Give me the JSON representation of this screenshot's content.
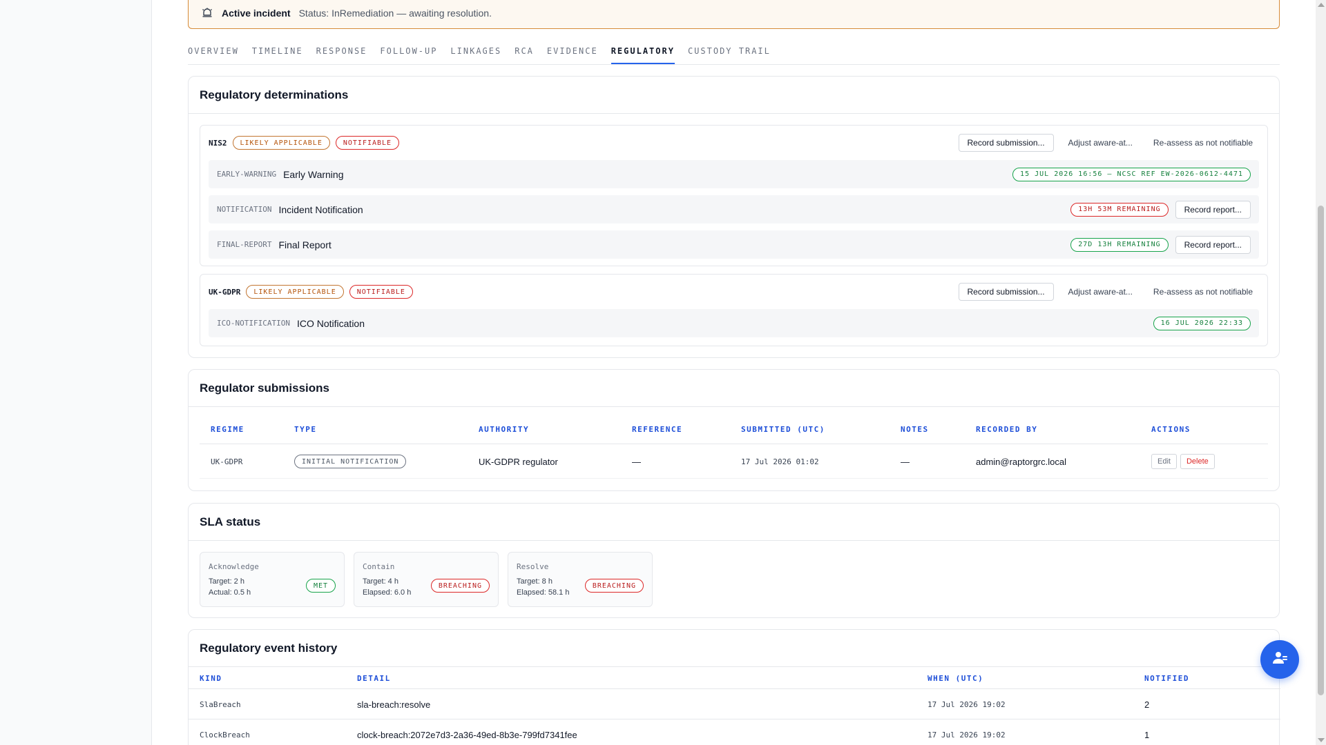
{
  "banner": {
    "icon": "bell-icon",
    "title": "Active incident",
    "status": "Status: InRemediation — awaiting resolution."
  },
  "tabs": [
    {
      "label": "OVERVIEW",
      "active": false
    },
    {
      "label": "TIMELINE",
      "active": false
    },
    {
      "label": "RESPONSE",
      "active": false
    },
    {
      "label": "FOLLOW-UP",
      "active": false
    },
    {
      "label": "LINKAGES",
      "active": false
    },
    {
      "label": "RCA",
      "active": false
    },
    {
      "label": "EVIDENCE",
      "active": false
    },
    {
      "label": "REGULATORY",
      "active": true
    },
    {
      "label": "CUSTODY TRAIL",
      "active": false
    }
  ],
  "determinations": {
    "title": "Regulatory determinations",
    "regimes": [
      {
        "name": "NIS2",
        "badges": [
          "LIKELY APPLICABLE",
          "NOTIFIABLE"
        ],
        "actions": {
          "record": "Record submission...",
          "adjust": "Adjust aware-at...",
          "reassess": "Re-assess as not notifiable"
        },
        "obligations": [
          {
            "code": "EARLY-WARNING",
            "label": "Early Warning",
            "status": "15 JUL 2026 16:56 — NCSC REF EW-2026-0612-4471",
            "status_color": "green",
            "button": ""
          },
          {
            "code": "NOTIFICATION",
            "label": "Incident Notification",
            "status": "13H 53M REMAINING",
            "status_color": "red",
            "button": "Record report..."
          },
          {
            "code": "FINAL-REPORT",
            "label": "Final Report",
            "status": "27D 13H REMAINING",
            "status_color": "green",
            "button": "Record report..."
          }
        ]
      },
      {
        "name": "UK-GDPR",
        "badges": [
          "LIKELY APPLICABLE",
          "NOTIFIABLE"
        ],
        "actions": {
          "record": "Record submission...",
          "adjust": "Adjust aware-at...",
          "reassess": "Re-assess as not notifiable"
        },
        "obligations": [
          {
            "code": "ICO-NOTIFICATION",
            "label": "ICO Notification",
            "status": "16 JUL 2026 22:33",
            "status_color": "green",
            "button": ""
          }
        ]
      }
    ]
  },
  "submissions": {
    "title": "Regulator submissions",
    "columns": [
      "REGIME",
      "TYPE",
      "AUTHORITY",
      "REFERENCE",
      "SUBMITTED (UTC)",
      "NOTES",
      "RECORDED BY",
      "ACTIONS"
    ],
    "rows": [
      {
        "regime": "UK-GDPR",
        "type": "INITIAL NOTIFICATION",
        "authority": "UK-GDPR regulator",
        "reference": "—",
        "submitted": "17 Jul 2026 01:02",
        "notes": "—",
        "recorded_by": "admin@raptorgrc.local",
        "edit": "Edit",
        "delete": "Delete"
      }
    ]
  },
  "sla": {
    "title": "SLA status",
    "items": [
      {
        "name": "Acknowledge",
        "target": "Target: 2 h",
        "metric": "Actual: 0.5 h",
        "status": "MET",
        "status_color": "green"
      },
      {
        "name": "Contain",
        "target": "Target: 4 h",
        "metric": "Elapsed: 6.0 h",
        "status": "BREACHING",
        "status_color": "red"
      },
      {
        "name": "Resolve",
        "target": "Target: 8 h",
        "metric": "Elapsed: 58.1 h",
        "status": "BREACHING",
        "status_color": "red"
      }
    ]
  },
  "history": {
    "title": "Regulatory event history",
    "columns": [
      "KIND",
      "DETAIL",
      "WHEN (UTC)",
      "NOTIFIED"
    ],
    "rows": [
      {
        "kind": "SlaBreach",
        "detail": "sla-breach:resolve",
        "when": "17 Jul 2026 19:02",
        "notified": "2"
      },
      {
        "kind": "ClockBreach",
        "detail": "clock-breach:2072e7d3-2a36-49ed-8b3e-799fd7341fee",
        "when": "17 Jul 2026 19:02",
        "notified": "1"
      }
    ]
  },
  "fab": {
    "icon": "user-add-icon"
  },
  "colors": {
    "accent": "#2563eb",
    "banner_border": "#d68a37",
    "ok": "#16a34a",
    "danger": "#dc2626",
    "amber": "#b45309"
  }
}
